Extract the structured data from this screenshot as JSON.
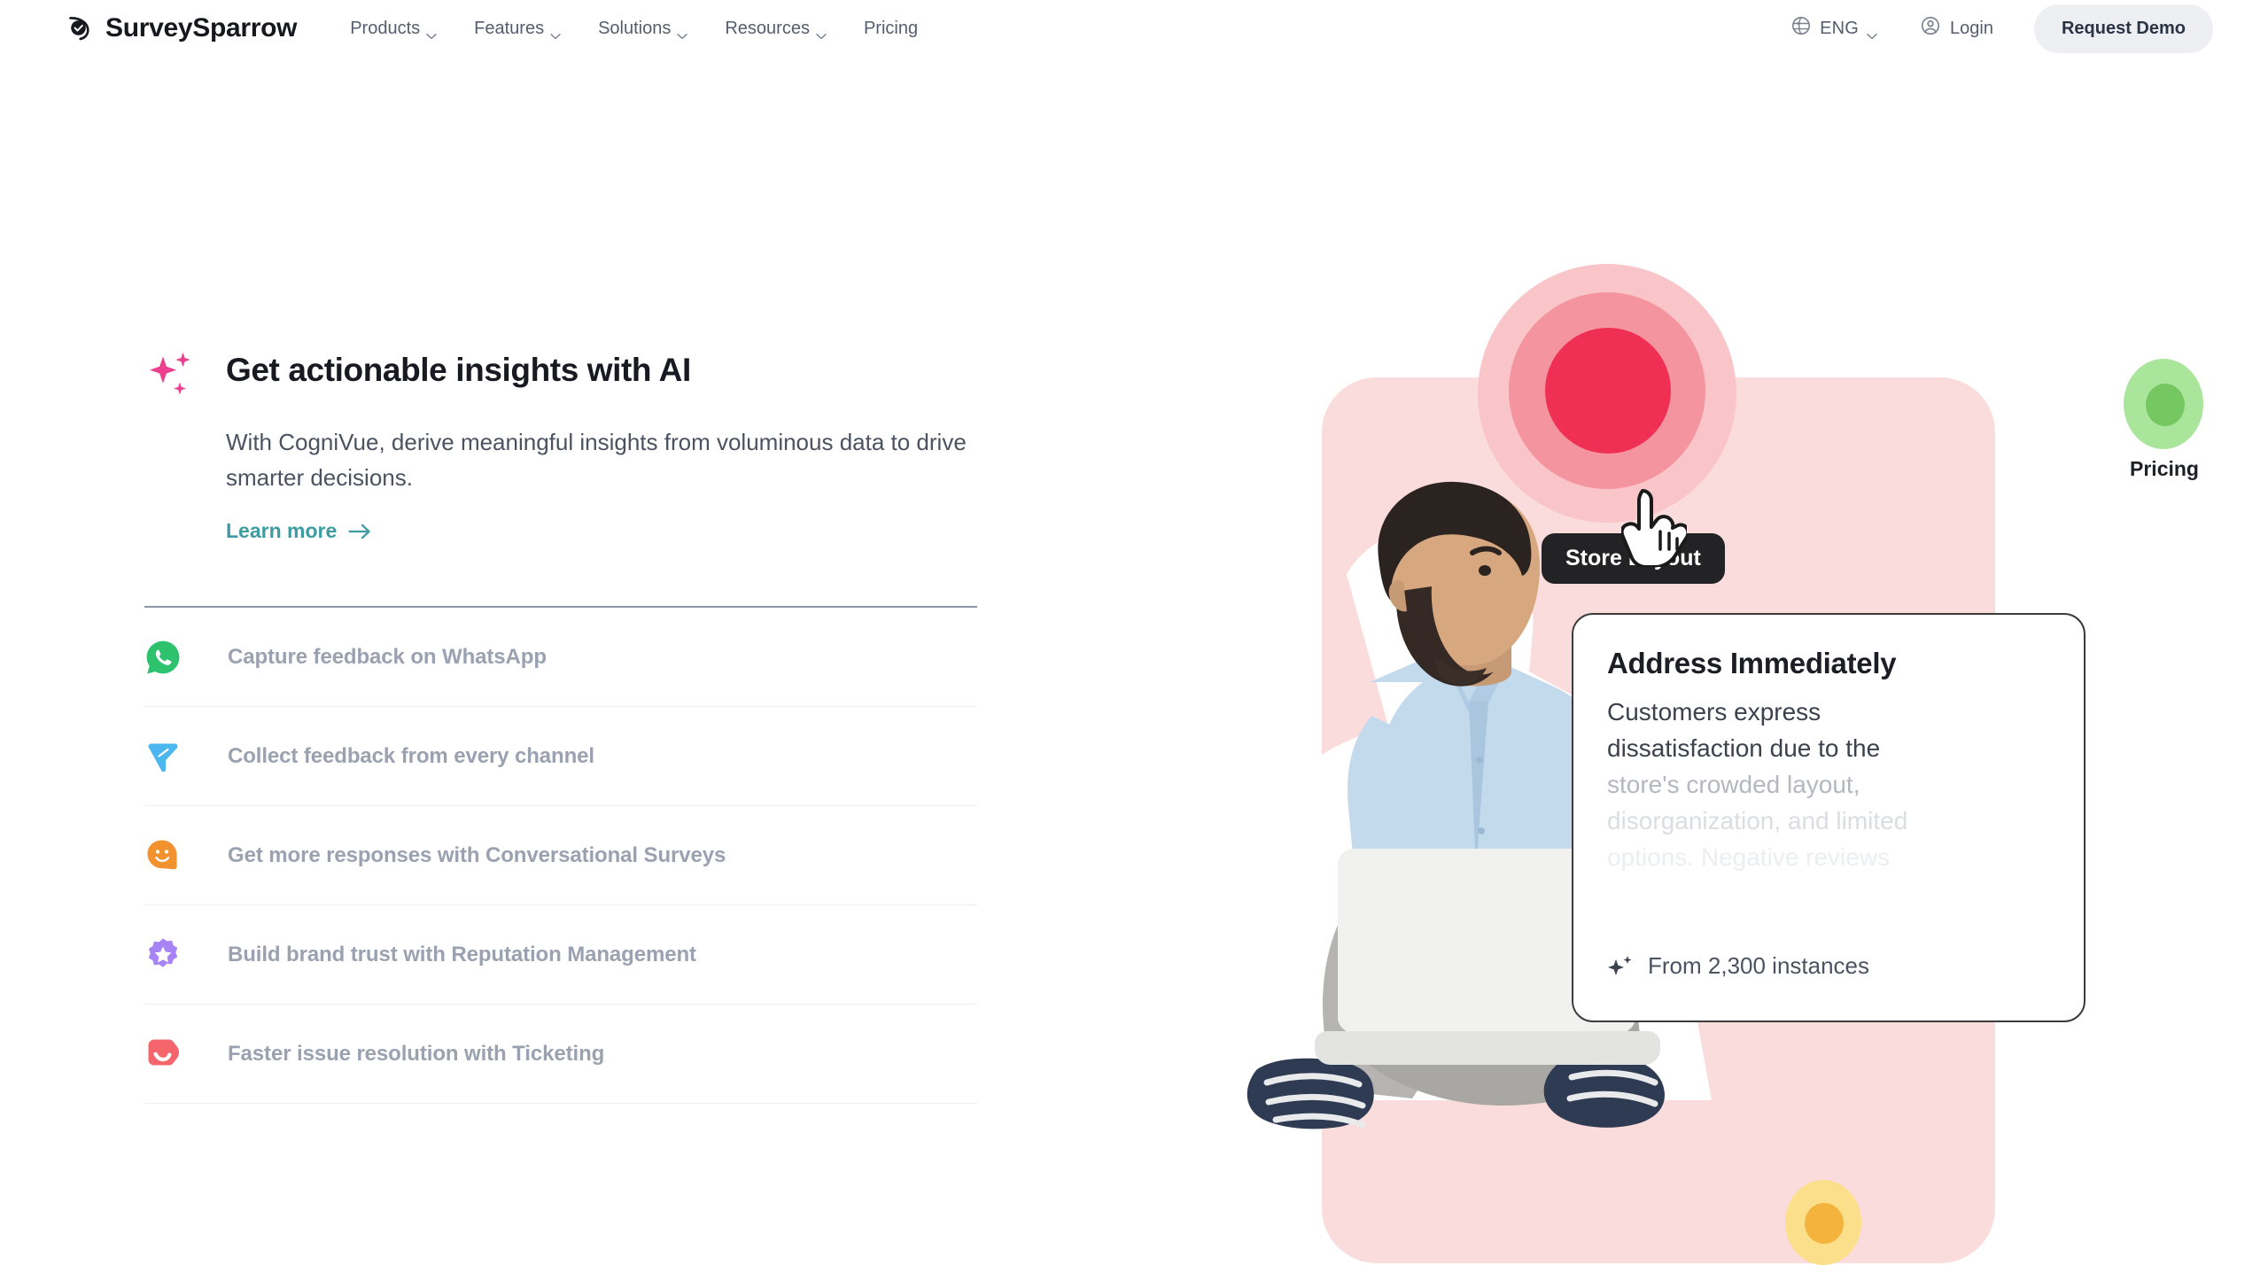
{
  "header": {
    "brand": "SurveySparrow",
    "brand_icon": "sparrow-logo-icon",
    "nav": [
      {
        "label": "Products",
        "has_caret": true
      },
      {
        "label": "Features",
        "has_caret": true
      },
      {
        "label": "Solutions",
        "has_caret": true
      },
      {
        "label": "Resources",
        "has_caret": true
      },
      {
        "label": "Pricing",
        "has_caret": false
      }
    ],
    "language": {
      "label": "ENG",
      "icon": "globe-icon",
      "caret_icon": "chevron-down-icon"
    },
    "login": {
      "label": "Login",
      "icon": "user-circle-icon"
    },
    "demo_button": {
      "label": "Request Demo",
      "bg": "#edeff3",
      "color": "#2b3445"
    }
  },
  "feature": {
    "icon": "sparkles-icon",
    "icon_color": "#ec3f8f",
    "title": "Get actionable insights with AI",
    "body": "With CogniVue, derive meaningful insights from voluminous data to drive smarter decisions.",
    "link": {
      "label": "Learn more",
      "icon": "arrow-right-icon",
      "color": "#3e9ba0"
    }
  },
  "feature_list": [
    {
      "label": "Capture feedback on WhatsApp",
      "icon": "whatsapp-icon",
      "color": "#2fc26e"
    },
    {
      "label": "Collect feedback from every channel",
      "icon": "paper-plane-icon",
      "color": "#4cb7ef"
    },
    {
      "label": "Get more responses with Conversational Surveys",
      "icon": "smiley-chat-icon",
      "color": "#f2922f"
    },
    {
      "label": "Build brand trust with Reputation Management",
      "icon": "star-badge-icon",
      "color": "#a883f5"
    },
    {
      "label": "Faster issue resolution with Ticketing",
      "icon": "ticket-check-icon",
      "color": "#f4656c"
    }
  ],
  "illustration": {
    "tooltip": {
      "label": "Store Layout",
      "bg": "#232326",
      "color": "#ffffff"
    },
    "cursor_icon": "pointing-hand-cursor-icon",
    "pricing_marker": {
      "label": "Pricing",
      "outer": "#a9e59a",
      "inner": "#74c761"
    },
    "target_marker": {
      "outer": "#f9c5c9",
      "middle": "#f4949e",
      "inner": "#ef3054"
    },
    "yellow_marker": {
      "outer": "#fbdf8a",
      "inner": "#f3b33d"
    },
    "card": {
      "title": "Address Immediately",
      "lines": [
        "Customers express",
        "dissatisfaction due to the",
        "store's crowded layout,",
        "disorganization, and limited",
        "options. Negative reviews"
      ],
      "footer": {
        "icon": "sparkles-icon",
        "text": "From 2,300 instances"
      }
    },
    "person_alt": "man-sitting-crosslegged-with-laptop"
  }
}
